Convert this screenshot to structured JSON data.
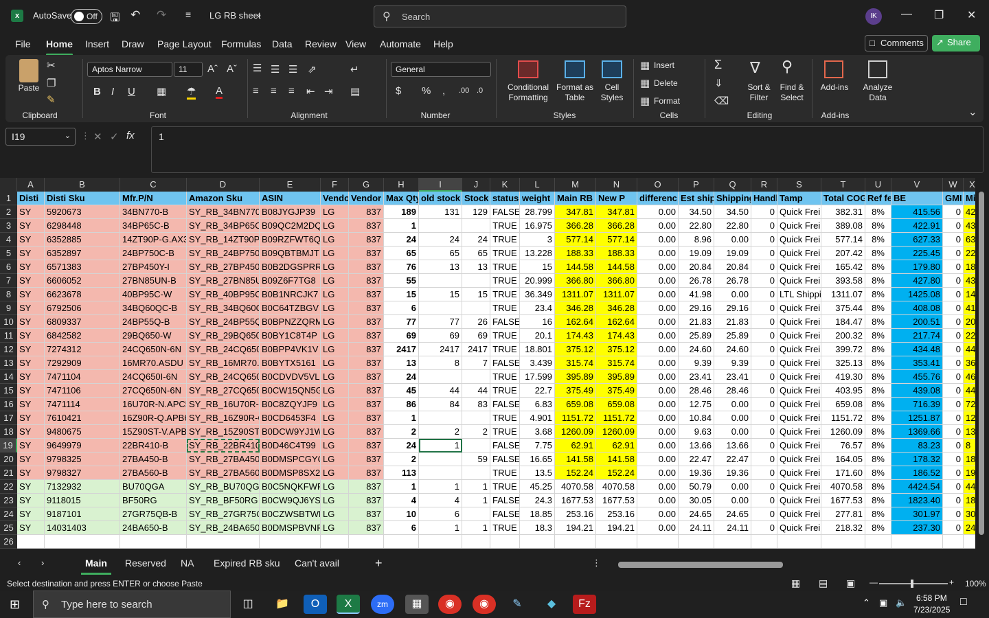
{
  "app": {
    "autosave_label": "AutoSave",
    "autosave_state": "Off",
    "title": "LG RB sheet",
    "search_placeholder": "Search",
    "user_initials": "IK"
  },
  "menus": [
    "File",
    "Home",
    "Insert",
    "Draw",
    "Page Layout",
    "Formulas",
    "Data",
    "Review",
    "View",
    "Automate",
    "Help"
  ],
  "header_buttons": {
    "comments": "Comments",
    "share": "Share"
  },
  "ribbon": {
    "paste": "Paste",
    "clipboard": "Clipboard",
    "font_name": "Aptos Narrow",
    "font_size": "11",
    "font": "Font",
    "alignment": "Alignment",
    "number_format": "General",
    "number": "Number",
    "conditional": "Conditional",
    "formatting": "Formatting",
    "format_as": "Format as",
    "table": "Table",
    "cell": "Cell",
    "styles_btn": "Styles",
    "styles": "Styles",
    "insert": "Insert",
    "delete": "Delete",
    "format": "Format",
    "cells": "Cells",
    "sort": "Sort &",
    "filter": "Filter",
    "find": "Find &",
    "select": "Select",
    "editing": "Editing",
    "addins_btn": "Add-ins",
    "analyze": "Analyze",
    "data_btn": "Data",
    "addins": "Add-ins"
  },
  "formula_bar": {
    "name_box": "I19",
    "fx": "fx",
    "value": "1"
  },
  "columns": [
    "A",
    "B",
    "C",
    "D",
    "E",
    "F",
    "G",
    "H",
    "I",
    "J",
    "K",
    "L",
    "M",
    "N",
    "O",
    "P",
    "Q",
    "R",
    "S",
    "T",
    "U",
    "V",
    "W",
    "X"
  ],
  "header_row": [
    "Disti",
    "Disti Sku",
    "Mfr.P/N",
    "Amazon Sku",
    "ASIN",
    "Vendo",
    "Vendor",
    "Max Qty",
    "old stock",
    "Stock",
    "status",
    "weight",
    "Main RB P",
    "New P",
    "differenc",
    "Est ship",
    "Shipping",
    "Handl",
    "Tamp",
    "Total COG",
    "Ref fe",
    "BE",
    "GMI",
    "Min"
  ],
  "rows": [
    [
      "SY",
      "5920673",
      "34BN770-B",
      "SY_RB_34BN770-B",
      "B08JYGJP39",
      "LG",
      "837",
      "189",
      "131",
      "129",
      "FALSE",
      "28.799",
      "347.81",
      "347.81",
      "0.00",
      "34.50",
      "34.50",
      "0",
      "Quick Frei",
      "382.31",
      "8%",
      "415.56",
      "0",
      "42"
    ],
    [
      "SY",
      "6298448",
      "34BP65C-B",
      "SY_RB_34BP65C-B",
      "B09QC2M2DQ",
      "LG",
      "837",
      "1",
      "",
      "",
      "TRUE",
      "16.975",
      "366.28",
      "366.28",
      "0.00",
      "22.80",
      "22.80",
      "0",
      "Quick Frei",
      "389.08",
      "8%",
      "422.91",
      "0",
      "43"
    ],
    [
      "SY",
      "6352885",
      "14ZT90P-G.AX33",
      "SY_RB_14ZT90P-G",
      "B09RZFWT6Q",
      "LG",
      "837",
      "24",
      "24",
      "24",
      "TRUE",
      "3",
      "577.14",
      "577.14",
      "0.00",
      "8.96",
      "0.00",
      "0",
      "Quick Frei",
      "577.14",
      "8%",
      "627.33",
      "0",
      "63"
    ],
    [
      "SY",
      "6352897",
      "24BP750C-B",
      "SY_RB_24BP750C",
      "B09QBTBMJT",
      "LG",
      "837",
      "65",
      "65",
      "65",
      "TRUE",
      "13.228",
      "188.33",
      "188.33",
      "0.00",
      "19.09",
      "19.09",
      "0",
      "Quick Frei",
      "207.42",
      "8%",
      "225.45",
      "0",
      "22"
    ],
    [
      "SY",
      "6571383",
      "27BP450Y-I",
      "SY_RB_27BP450Y",
      "B0B2DGSPRR",
      "LG",
      "837",
      "76",
      "13",
      "13",
      "TRUE",
      "15",
      "144.58",
      "144.58",
      "0.00",
      "20.84",
      "20.84",
      "0",
      "Quick Frei",
      "165.42",
      "8%",
      "179.80",
      "0",
      "18"
    ],
    [
      "SY",
      "6606052",
      "27BN85UN-B",
      "SY_RB_27BN85UN",
      "B09Z6F7TG8",
      "LG",
      "837",
      "55",
      "",
      "",
      "TRUE",
      "20.999",
      "366.80",
      "366.80",
      "0.00",
      "26.78",
      "26.78",
      "0",
      "Quick Frei",
      "393.58",
      "8%",
      "427.80",
      "0",
      "43"
    ],
    [
      "SY",
      "6623678",
      "40BP95C-W",
      "SY_RB_40BP95C-W",
      "B0B1NRCJK7",
      "LG",
      "837",
      "15",
      "15",
      "15",
      "TRUE",
      "36.349",
      "1311.07",
      "1311.07",
      "0.00",
      "41.98",
      "0.00",
      "0",
      "LTL Shippi",
      "1311.07",
      "8%",
      "1425.08",
      "0",
      "14"
    ],
    [
      "SY",
      "6792506",
      "34BQ60QC-B",
      "SY_RB_34BQ60QC",
      "B0C64TZBGV",
      "LG",
      "837",
      "6",
      "",
      "",
      "TRUE",
      "23.4",
      "346.28",
      "346.28",
      "0.00",
      "29.16",
      "29.16",
      "0",
      "Quick Frei",
      "375.44",
      "8%",
      "408.08",
      "0",
      "41"
    ],
    [
      "SY",
      "6809337",
      "24BP55Q-B",
      "SY_RB_24BP55Q-B",
      "B0BPNZZQRM",
      "LG",
      "837",
      "77",
      "77",
      "26",
      "FALSE",
      "16",
      "162.64",
      "162.64",
      "0.00",
      "21.83",
      "21.83",
      "0",
      "Quick Frei",
      "184.47",
      "8%",
      "200.51",
      "0",
      "20"
    ],
    [
      "SY",
      "6842582",
      "29BQ650-W",
      "SY_RB_29BQ650-W",
      "B0BY1C8T4P",
      "LG",
      "837",
      "69",
      "69",
      "69",
      "TRUE",
      "20.1",
      "174.43",
      "174.43",
      "0.00",
      "25.89",
      "25.89",
      "0",
      "Quick Frei",
      "200.32",
      "8%",
      "217.74",
      "0",
      "22"
    ],
    [
      "SY",
      "7274312",
      "24CQ650N-6N",
      "SY_RB_24CQ650N",
      "B0BPP4VK1V",
      "LG",
      "837",
      "2417",
      "2417",
      "2417",
      "TRUE",
      "18.801",
      "375.12",
      "375.12",
      "0.00",
      "24.60",
      "24.60",
      "0",
      "Quick Frei",
      "399.72",
      "8%",
      "434.48",
      "0",
      "44"
    ],
    [
      "SY",
      "7292909",
      "16MR70.ASDU",
      "SY_RB_16MR70.AS",
      "B0BYTX5161",
      "LG",
      "837",
      "13",
      "8",
      "7",
      "FALSE",
      "3.439",
      "315.74",
      "315.74",
      "0.00",
      "9.39",
      "9.39",
      "0",
      "Quick Frei",
      "325.13",
      "8%",
      "353.41",
      "0",
      "36"
    ],
    [
      "SY",
      "7471104",
      "24CQ650I-6N",
      "SY_RB_24CQ650I-",
      "B0CDVDV5VL",
      "LG",
      "837",
      "24",
      "",
      "",
      "TRUE",
      "17.599",
      "395.89",
      "395.89",
      "0.00",
      "23.41",
      "23.41",
      "0",
      "Quick Frei",
      "419.30",
      "8%",
      "455.76",
      "0",
      "46"
    ],
    [
      "SY",
      "7471106",
      "27CQ650N-6N",
      "SY_RB_27CQ650N",
      "B0CW15QN5G",
      "LG",
      "837",
      "45",
      "44",
      "44",
      "TRUE",
      "22.7",
      "375.49",
      "375.49",
      "0.00",
      "28.46",
      "28.46",
      "0",
      "Quick Frei",
      "403.95",
      "8%",
      "439.08",
      "0",
      "44"
    ],
    [
      "SY",
      "7471114",
      "16U70R-N.APC5",
      "SY_RB_16U70R-N",
      "B0C8ZQYJF9",
      "LG",
      "837",
      "86",
      "84",
      "83",
      "FALSE",
      "6.83",
      "659.08",
      "659.08",
      "0.00",
      "12.75",
      "0.00",
      "0",
      "Quick Frei",
      "659.08",
      "8%",
      "716.39",
      "0",
      "72"
    ],
    [
      "SY",
      "7610421",
      "16Z90R-Q.APB6",
      "SY_RB_16Z90R-Q.",
      "B0CD6453F4",
      "LG",
      "837",
      "1",
      "",
      "",
      "TRUE",
      "4.901",
      "1151.72",
      "1151.72",
      "0.00",
      "10.84",
      "0.00",
      "0",
      "Quick Frei",
      "1151.72",
      "8%",
      "1251.87",
      "0",
      "12"
    ],
    [
      "SY",
      "9480675",
      "15Z90ST-V.APB6",
      "SY_RB_15Z90ST-V",
      "B0DCW9YJ1W",
      "LG",
      "837",
      "2",
      "2",
      "2",
      "TRUE",
      "3.68",
      "1260.09",
      "1260.09",
      "0.00",
      "9.63",
      "0.00",
      "0",
      "Quick Frei",
      "1260.09",
      "8%",
      "1369.66",
      "0",
      "13"
    ],
    [
      "SY",
      "9649979",
      "22BR410-B",
      "SY_RB_22BR410-B",
      "B0D46C4T99",
      "LG",
      "837",
      "24",
      "1",
      "",
      "FALSE",
      "7.75",
      "62.91",
      "62.91",
      "0.00",
      "13.66",
      "13.66",
      "0",
      "Quick Frei",
      "76.57",
      "8%",
      "83.23",
      "0",
      "8"
    ],
    [
      "SY",
      "9798325",
      "27BA450-B",
      "SY_RB_27BA450-B",
      "B0DMSPCGYQ",
      "LG",
      "837",
      "2",
      "",
      "59",
      "FALSE",
      "16.65",
      "141.58",
      "141.58",
      "0.00",
      "22.47",
      "22.47",
      "0",
      "Quick Frei",
      "164.05",
      "8%",
      "178.32",
      "0",
      "18"
    ],
    [
      "SY",
      "9798327",
      "27BA560-B",
      "SY_RB_27BA560-B",
      "B0DMSP8SX2",
      "LG",
      "837",
      "113",
      "",
      "",
      "TRUE",
      "13.5",
      "152.24",
      "152.24",
      "0.00",
      "19.36",
      "19.36",
      "0",
      "Quick Frei",
      "171.60",
      "8%",
      "186.52",
      "0",
      "19"
    ],
    [
      "SY",
      "7132932",
      "BU70QGA",
      "SY_RB_BU70QGA",
      "B0C5NQKFWP",
      "LG",
      "837",
      "1",
      "1",
      "1",
      "TRUE",
      "45.25",
      "4070.58",
      "4070.58",
      "0.00",
      "50.79",
      "0.00",
      "0",
      "Quick Frei",
      "4070.58",
      "8%",
      "4424.54",
      "0",
      "44"
    ],
    [
      "SY",
      "9118015",
      "BF50RG",
      "SY_RB_BF50RG",
      "B0CW9QJ6YS",
      "LG",
      "837",
      "4",
      "4",
      "1",
      "FALSE",
      "24.3",
      "1677.53",
      "1677.53",
      "0.00",
      "30.05",
      "0.00",
      "0",
      "Quick Frei",
      "1677.53",
      "8%",
      "1823.40",
      "0",
      "18"
    ],
    [
      "SY",
      "9187101",
      "27GR75QB-B",
      "SY_RB_27GR75QB",
      "B0CZWSBTWR",
      "LG",
      "837",
      "10",
      "6",
      "",
      "FALSE",
      "18.85",
      "253.16",
      "253.16",
      "0.00",
      "24.65",
      "24.65",
      "0",
      "Quick Frei",
      "277.81",
      "8%",
      "301.97",
      "0",
      "30"
    ],
    [
      "SY",
      "14031403",
      "24BA650-B",
      "SY_RB_24BA650-B",
      "B0DMSPBVNF",
      "LG",
      "837",
      "6",
      "1",
      "1",
      "TRUE",
      "18.3",
      "194.21",
      "194.21",
      "0.00",
      "24.11",
      "24.11",
      "0",
      "Quick Frei",
      "218.32",
      "8%",
      "237.30",
      "0",
      "24"
    ]
  ],
  "sheet_tabs": [
    "Main",
    "Reserved",
    "NA",
    "Expired RB sku",
    "Can't avail"
  ],
  "status_bar": {
    "message": "Select destination and press ENTER or choose Paste",
    "zoom": "100%"
  },
  "taskbar": {
    "search_placeholder": "Type here to search",
    "time": "6:58 PM",
    "date": "7/23/2025"
  },
  "colors": {
    "header_blue": "#6fc4f0",
    "row_red": "#f4b8ae",
    "row_green": "#d9f2d0",
    "highlight_yellow": "#ffff00",
    "be_blue": "#00b0f0",
    "accent_green": "#3fae5f"
  }
}
